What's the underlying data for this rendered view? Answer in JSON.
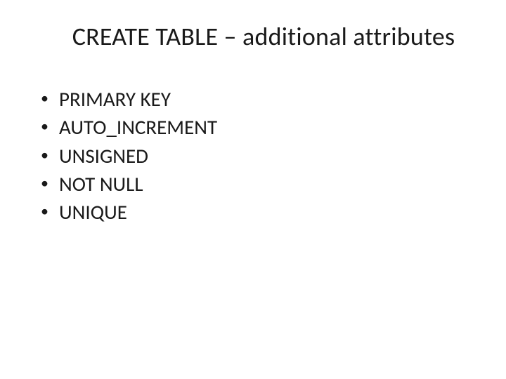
{
  "slide": {
    "title": "CREATE TABLE – additional attributes",
    "bullets": [
      "PRIMARY KEY",
      "AUTO_INCREMENT",
      "UNSIGNED",
      "NOT NULL",
      "UNIQUE"
    ]
  }
}
